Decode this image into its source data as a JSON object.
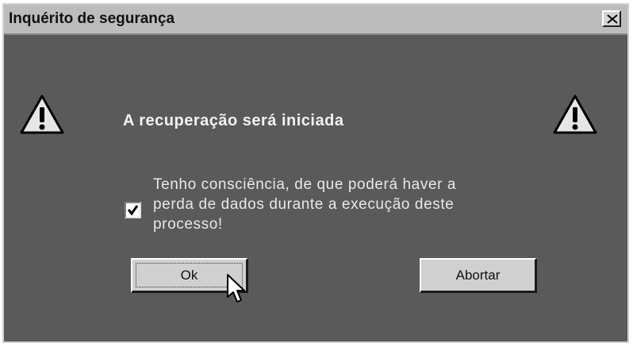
{
  "dialog": {
    "title": "Inquérito de segurança",
    "heading": "A recuperação será iniciada",
    "confirmation": {
      "checked": true,
      "text": "Tenho consciência, de que poderá haver a perda de dados durante a execução deste processo!"
    },
    "buttons": {
      "ok": "Ok",
      "abort": "Abortar"
    },
    "icons": {
      "close": "close-icon",
      "warning": "warning-icon",
      "check": "checkmark-icon",
      "cursor": "mouse-pointer-icon"
    },
    "colors": {
      "background": "#5a5a5a",
      "titlebar": "#bcbcbc",
      "button_face": "#d0d0d0"
    }
  }
}
